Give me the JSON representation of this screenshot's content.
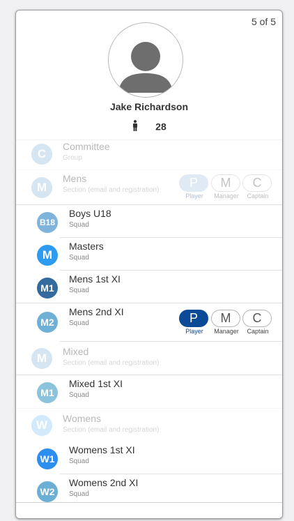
{
  "header": {
    "pager": "5 of 5"
  },
  "profile": {
    "name": "Jake Richardson",
    "age": "28",
    "avatar_icon": "user-silhouette-icon",
    "gender_icon": "male-person-icon"
  },
  "roles": {
    "p": {
      "short": "P",
      "label": "Player"
    },
    "m": {
      "short": "M",
      "label": "Manager"
    },
    "c": {
      "short": "C",
      "label": "Captain"
    }
  },
  "groups": [
    {
      "badge": "C",
      "title": "Committee",
      "subtitle": "Group",
      "color": "#8ab7da"
    },
    {
      "badge": "M",
      "title": "Mens",
      "subtitle": "Section (email and registration)",
      "color": "#8ab7da"
    },
    {
      "badge": "B18",
      "title": "Boys U18",
      "subtitle": "Squad",
      "color": "#7eb4dc"
    },
    {
      "badge": "M",
      "title": "Masters",
      "subtitle": "Squad",
      "color": "#2d9cf0"
    },
    {
      "badge": "M1",
      "title": "Mens 1st XI",
      "subtitle": "Squad",
      "color": "#356a9f"
    },
    {
      "badge": "M2",
      "title": "Mens 2nd XI",
      "subtitle": "Squad",
      "color": "#6eb0d6"
    },
    {
      "badge": "M",
      "title": "Mixed",
      "subtitle": "Section (email and registration)",
      "color": "#8ab7da"
    },
    {
      "badge": "M1",
      "title": "Mixed 1st XI",
      "subtitle": "Squad",
      "color": "#8cc3dc"
    },
    {
      "badge": "W",
      "title": "Womens",
      "subtitle": "Section (email and registration)",
      "color": "#7fc4f5"
    },
    {
      "badge": "W1",
      "title": "Womens 1st XI",
      "subtitle": "Squad",
      "color": "#2c8ff0"
    },
    {
      "badge": "W2",
      "title": "Womens 2nd XI",
      "subtitle": "Squad",
      "color": "#6cafd4"
    }
  ]
}
